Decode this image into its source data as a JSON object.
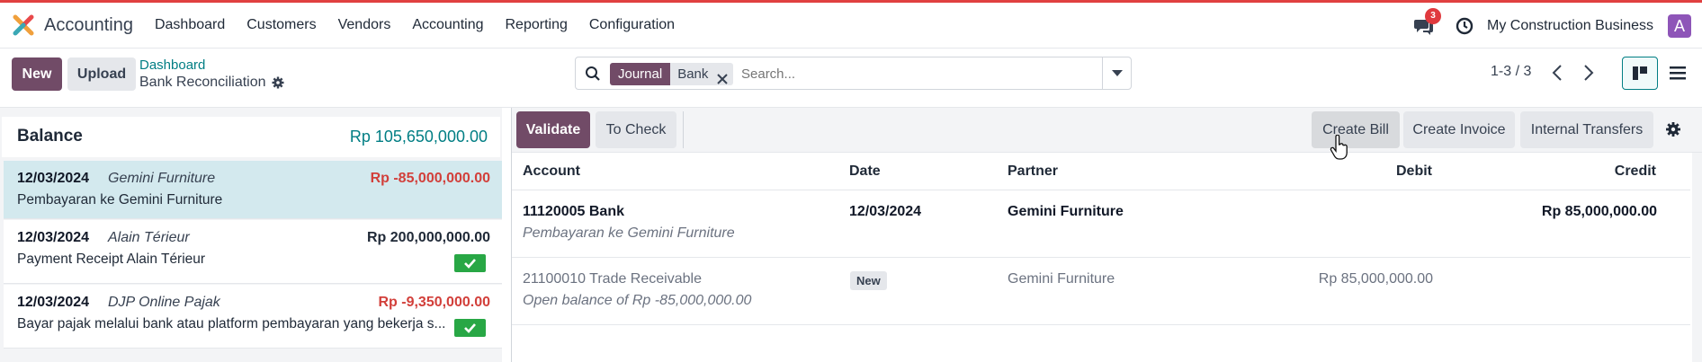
{
  "app": {
    "name": "Accounting"
  },
  "menu": [
    "Dashboard",
    "Customers",
    "Vendors",
    "Accounting",
    "Reporting",
    "Configuration"
  ],
  "systray": {
    "messages_count": "3",
    "company": "My Construction Business",
    "avatar_letter": "A"
  },
  "control": {
    "new_label": "New",
    "upload_label": "Upload",
    "breadcrumb_parent": "Dashboard",
    "breadcrumb_current": "Bank Reconciliation",
    "facet_key": "Journal",
    "facet_value": "Bank",
    "search_placeholder": "Search...",
    "pager": "1-3 / 3"
  },
  "balance": {
    "label": "Balance",
    "amount": "Rp 105,650,000.00"
  },
  "statements": [
    {
      "date": "12/03/2024",
      "partner": "Gemini Furniture",
      "amount": "Rp -85,000,000.00",
      "label": "Pembayaran ke Gemini Furniture",
      "selected": true,
      "reconciled": false
    },
    {
      "date": "12/03/2024",
      "partner": "Alain Térieur",
      "amount": "Rp 200,000,000.00",
      "label": "Payment Receipt Alain Térieur",
      "selected": false,
      "reconciled": true
    },
    {
      "date": "12/03/2024",
      "partner": "DJP Online Pajak",
      "amount": "Rp -9,350,000.00",
      "label": "Bayar pajak melalui bank atau platform pembayaran yang bekerja s...",
      "selected": false,
      "reconciled": true
    }
  ],
  "actions": {
    "validate": "Validate",
    "to_check": "To Check",
    "create_bill": "Create Bill",
    "create_invoice": "Create Invoice",
    "internal_transfers": "Internal Transfers"
  },
  "table": {
    "headers": {
      "account": "Account",
      "date": "Date",
      "partner": "Partner",
      "debit": "Debit",
      "credit": "Credit"
    },
    "rows": [
      {
        "account": "11120005 Bank",
        "label": "Pembayaran ke Gemini Furniture",
        "date": "12/03/2024",
        "partner": "Gemini Furniture",
        "debit": "",
        "credit": "Rp 85,000,000.00"
      },
      {
        "account": "21100010 Trade Receivable",
        "label": "Open balance of Rp -85,000,000.00",
        "badge": "New",
        "partner": "Gemini Furniture",
        "debit": "Rp 85,000,000.00",
        "credit": ""
      }
    ]
  },
  "colors": {
    "primary": "#714b67",
    "teal": "#017e84",
    "negative": "#d23f3a",
    "selected_row": "#d3e9ee"
  }
}
